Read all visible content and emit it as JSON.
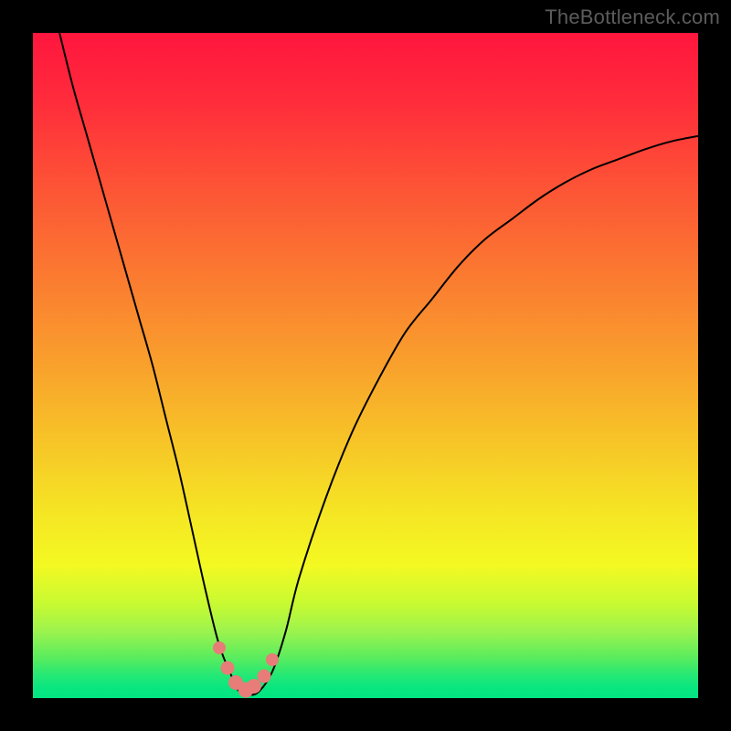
{
  "watermark": "TheBottleneck.com",
  "chart_data": {
    "type": "line",
    "title": "",
    "xlabel": "",
    "ylabel": "",
    "ylim": [
      0,
      100
    ],
    "xlim": [
      0,
      100
    ],
    "series": [
      {
        "name": "bottleneck-curve",
        "x": [
          4,
          6,
          8,
          10,
          12,
          14,
          16,
          18,
          20,
          22,
          24,
          26,
          28,
          30,
          31,
          32.5,
          34,
          36,
          38,
          40,
          44,
          48,
          52,
          56,
          60,
          64,
          68,
          72,
          76,
          80,
          84,
          88,
          92,
          96,
          100
        ],
        "values": [
          100,
          92,
          85,
          78,
          71,
          64,
          57,
          50,
          42,
          34,
          25,
          16,
          8,
          3,
          1,
          0.5,
          1,
          4,
          10,
          18,
          30,
          40,
          48,
          55,
          60,
          65,
          69,
          72,
          75,
          77.5,
          79.5,
          81,
          82.5,
          83.7,
          84.5
        ]
      }
    ],
    "markers": {
      "name": "highlight-points",
      "x": [
        28,
        29.2,
        30.5,
        32,
        33.3,
        34.8,
        36
      ],
      "values": [
        7.5,
        4.5,
        2.3,
        1.2,
        1.8,
        3.3,
        5.8
      ],
      "sizes": [
        14,
        15,
        16,
        17,
        16,
        15,
        14
      ],
      "color": "#e77c78"
    },
    "gradient_stops": [
      {
        "offset": 0.0,
        "color": "#ff163e"
      },
      {
        "offset": 0.1,
        "color": "#ff2b3b"
      },
      {
        "offset": 0.22,
        "color": "#fd5036"
      },
      {
        "offset": 0.35,
        "color": "#fb7631"
      },
      {
        "offset": 0.48,
        "color": "#f99b2d"
      },
      {
        "offset": 0.6,
        "color": "#f7c028"
      },
      {
        "offset": 0.72,
        "color": "#f5e524"
      },
      {
        "offset": 0.8,
        "color": "#f4f922"
      },
      {
        "offset": 0.86,
        "color": "#c6fa32"
      },
      {
        "offset": 0.9,
        "color": "#9cf34e"
      },
      {
        "offset": 0.94,
        "color": "#58ec5e"
      },
      {
        "offset": 0.965,
        "color": "#26e874"
      },
      {
        "offset": 0.985,
        "color": "#08e680"
      },
      {
        "offset": 1.0,
        "color": "#03e582"
      }
    ]
  }
}
